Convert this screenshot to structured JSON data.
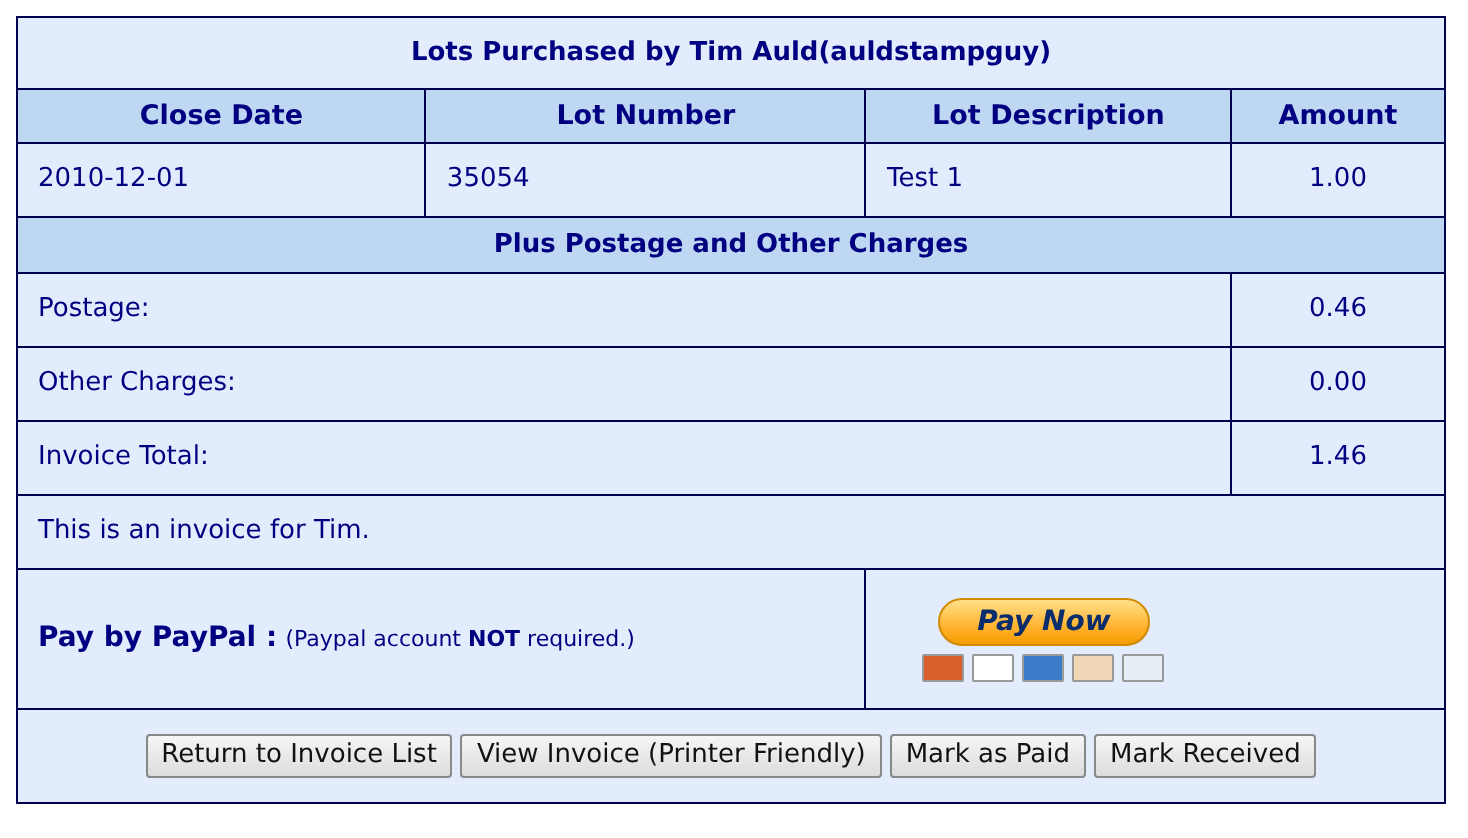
{
  "title": "Lots Purchased by Tim Auld(auldstampguy)",
  "columns": [
    "Close Date",
    "Lot Number",
    "Lot Description",
    "Amount"
  ],
  "rows": [
    [
      "2010-12-01",
      "35054",
      "Test 1",
      "1.00"
    ]
  ],
  "section_heading": "Plus Postage and Other Charges",
  "charges": [
    {
      "label": "Postage:",
      "amount": "0.46"
    },
    {
      "label": "Other Charges:",
      "amount": "0.00"
    },
    {
      "label": "Invoice Total:",
      "amount": "1.46"
    }
  ],
  "note": "This is an invoice for Tim.",
  "paypal": {
    "label": "Pay by PayPal :",
    "hint": "(Paypal account **NOT** required.)",
    "button": "Pay Now",
    "cards": [
      {
        "color": "#d8602a"
      },
      {
        "color": "#ffffff"
      },
      {
        "color": "#3a7cc7"
      },
      {
        "color": "#f3d8b8"
      },
      {
        "color": "#e8eef5"
      }
    ]
  },
  "buttons": [
    "Return to Invoice List",
    "View Invoice (Printer Friendly)",
    "Mark as Paid",
    "Mark Received"
  ]
}
